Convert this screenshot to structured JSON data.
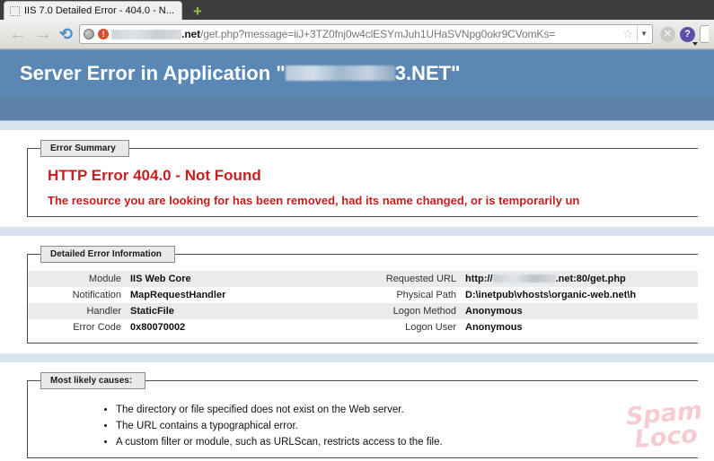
{
  "browser": {
    "tab": {
      "title": "IIS 7.0 Detailed Error - 404.0 - N...",
      "favicon": "generic-page-icon",
      "new_tab_label": "+"
    },
    "nav": {
      "back_glyph": "←",
      "forward_glyph": "→",
      "reload_glyph": "⟳"
    },
    "url_bar": {
      "globe_icon": "globe-icon",
      "warning_icon": "!",
      "redacted_domain": "",
      "url_suffix_domain": ".net",
      "url_path": "/get.php?message=iiJ+3TZ0fnj0w4clESYmJuh1UHaSVNpg0okr9CVomKs=",
      "bookmark_glyph": "☆",
      "dropdown_glyph": "▼"
    },
    "buttons": {
      "stop_glyph": "✕",
      "help_glyph": "?"
    }
  },
  "page": {
    "banner": {
      "prefix": "Server Error in Application \"",
      "redacted_app_name": "",
      "suffix": "3.NET\""
    },
    "error_summary": {
      "legend": "Error Summary",
      "heading": "HTTP Error 404.0 - Not Found",
      "description": "The resource you are looking for has been removed, had its name changed, or is temporarily un"
    },
    "detailed_error": {
      "legend": "Detailed Error Information",
      "left_rows": [
        {
          "label": "Module",
          "value": "IIS Web Core"
        },
        {
          "label": "Notification",
          "value": "MapRequestHandler"
        },
        {
          "label": "Handler",
          "value": "StaticFile"
        },
        {
          "label": "Error Code",
          "value": "0x80070002"
        }
      ],
      "right_rows": [
        {
          "label": "Requested URL",
          "value_prefix": "http://",
          "value_redacted": true,
          "value_suffix": ".net:80/get.php"
        },
        {
          "label": "Physical Path",
          "value_prefix": "D:\\inetpub\\vhosts\\organic-web.net\\h",
          "value_redacted": false,
          "value_suffix": ""
        },
        {
          "label": "Logon Method",
          "value_prefix": "Anonymous",
          "value_redacted": false,
          "value_suffix": ""
        },
        {
          "label": "Logon User",
          "value_prefix": "Anonymous",
          "value_redacted": false,
          "value_suffix": ""
        }
      ]
    },
    "most_likely_causes": {
      "legend": "Most likely causes:",
      "items": [
        "The directory or file specified does not exist on the Web server.",
        "The URL contains a typographical error.",
        "A custom filter or module, such as URLScan, restricts access to the file."
      ]
    },
    "watermark": {
      "line1": "Spam",
      "line2": "Loco"
    }
  },
  "colors": {
    "banner_blue": "#5a87b3",
    "banner_strip_blue": "#5c82a8",
    "error_red": "#c81e1e",
    "page_blue_bg": "#d7e4ef",
    "row_stripe": "#ebebeb",
    "watermark_pink": "#f4c4ca"
  }
}
